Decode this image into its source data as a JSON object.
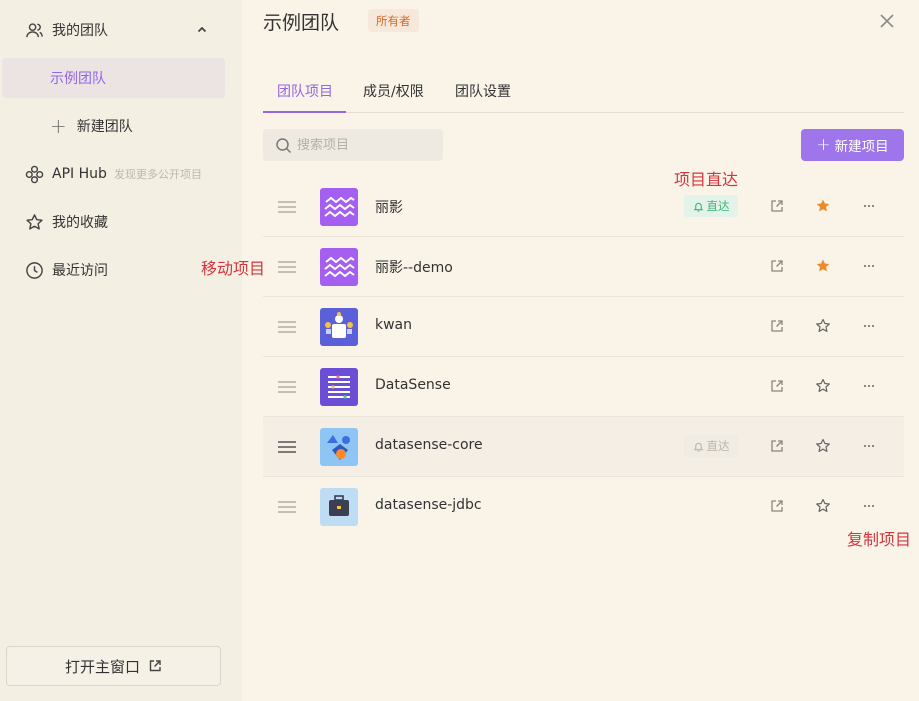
{
  "sidebar": {
    "my_team": "我的团队",
    "active_team": "示例团队",
    "new_team": "新建团队",
    "api_hub": "API Hub",
    "api_hub_hint": "发现更多公开项目",
    "favorites": "我的收藏",
    "recent": "最近访问",
    "open_main": "打开主窗口"
  },
  "header": {
    "title": "示例团队",
    "owner_badge": "所有者"
  },
  "tabs": [
    "团队项目",
    "成员/权限",
    "团队设置"
  ],
  "toolbar": {
    "search_placeholder": "搜索项目",
    "new_project": "新建项目"
  },
  "projects": [
    {
      "name": "丽影",
      "direct": "直达",
      "direct_state": "on",
      "starred": true
    },
    {
      "name": "丽影--demo",
      "direct": "",
      "direct_state": "none",
      "starred": true
    },
    {
      "name": "kwan",
      "direct": "",
      "direct_state": "none",
      "starred": false
    },
    {
      "name": "DataSense",
      "direct": "",
      "direct_state": "none",
      "starred": false
    },
    {
      "name": "datasense-core",
      "direct": "直达",
      "direct_state": "off",
      "starred": false
    },
    {
      "name": "datasense-jdbc",
      "direct": "",
      "direct_state": "none",
      "starred": false
    }
  ],
  "annotations": {
    "project_direct": "项目直达",
    "move_project": "移动项目",
    "copy_project": "复制项目"
  },
  "colors": {
    "accent": "#9366e6",
    "star": "#ef8a2a",
    "direct_on": "#3fb37a",
    "annotation": "#d6343e"
  }
}
